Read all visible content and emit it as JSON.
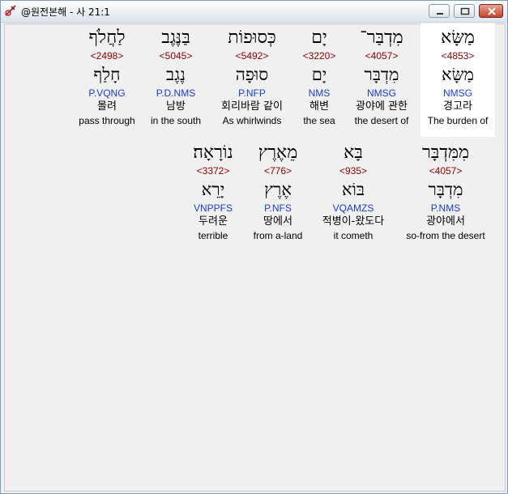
{
  "window": {
    "title": "@원전본해 - 사 21:1",
    "controls": {
      "minimize": "minimize",
      "maximize": "maximize",
      "close": "close"
    }
  },
  "verse": {
    "row1": [
      {
        "heb": "מַשָּׂא",
        "strong": "<4853>",
        "lemma": "מַשָּׂא",
        "morph": "NMSG",
        "kor": "경고라",
        "eng": "The burden of"
      },
      {
        "heb": "מִדְבַּר־",
        "strong": "<4057>",
        "lemma": "מִדְבָּר",
        "morph": "NMSG",
        "kor": "광야에 관한",
        "eng": "the desert of"
      },
      {
        "heb": "יָם",
        "strong": "<3220>",
        "lemma": "יָם",
        "morph": "NMS",
        "kor": "해변",
        "eng": "the sea"
      },
      {
        "heb": "כְּסוּפוֹת",
        "strong": "<5492>",
        "lemma": "סוּפָה",
        "morph": "P.NFP",
        "kor": "회리바람 같이",
        "eng": "As whirlwinds"
      },
      {
        "heb": "בַּנֶּגֶב",
        "strong": "<5045>",
        "lemma": "נֶגֶב",
        "morph": "P.D.NMS",
        "kor": "남방",
        "eng": "in the south"
      },
      {
        "heb": "לַחֲלֹף",
        "strong": "<2498>",
        "lemma": "חָלַף",
        "morph": "P.VQNG",
        "kor": "몰려",
        "eng": "pass through"
      }
    ],
    "row2": [
      {
        "heb": "מִמִּדְבָּר",
        "strong": "<4057>",
        "lemma": "מִדְבָּר",
        "morph": "P.NMS",
        "kor": "광야에서",
        "eng": "so-from the desert"
      },
      {
        "heb": "בָּא",
        "strong": "<935>",
        "lemma": "בּוֹא",
        "morph": "VQAMZS",
        "kor": "적병이-왔도다",
        "eng": "it cometh"
      },
      {
        "heb": "מֵאֶרֶץ",
        "strong": "<776>",
        "lemma": "אֶרֶץ",
        "morph": "P.NFS",
        "kor": "땅에서",
        "eng": "from a-land"
      },
      {
        "heb": "נוֹרָאָה׃",
        "strong": "<3372>",
        "lemma": "יָרֵא",
        "morph": "VNPPFS",
        "kor": "두려운",
        "eng": "terrible"
      }
    ]
  },
  "colors": {
    "strong": "#8b0000",
    "morph": "#1a3ccc",
    "highlight": "#ffffff"
  }
}
